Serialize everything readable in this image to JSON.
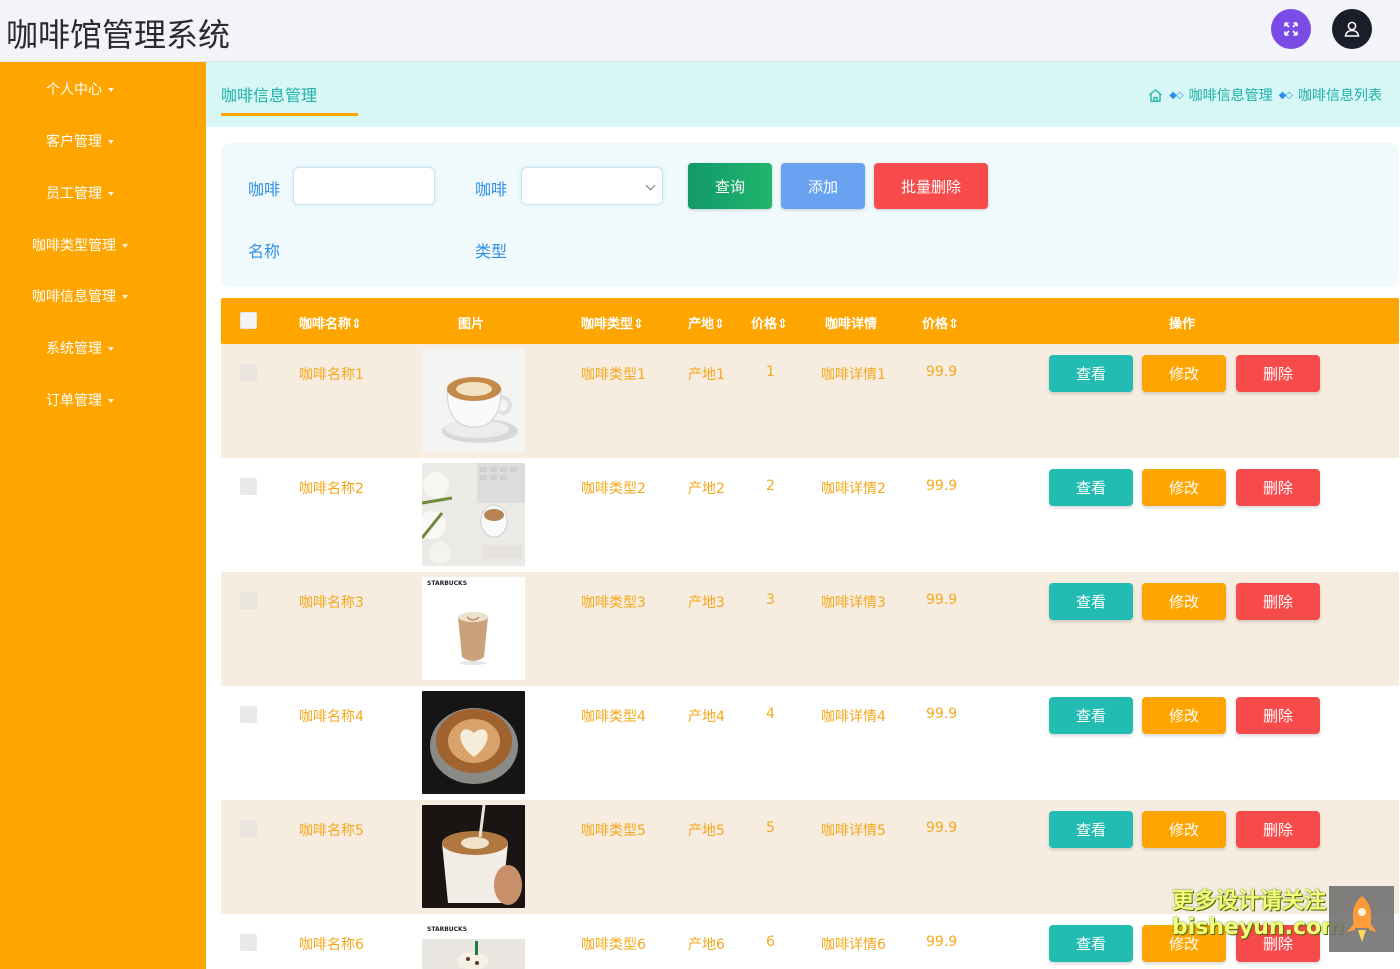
{
  "app": {
    "title": "咖啡馆管理系统"
  },
  "colors": {
    "accent": "#ffa500",
    "teal": "#1fb0a8",
    "blue": "#2f8fe6",
    "query": "#17a96a",
    "add": "#6aa2f2",
    "danger": "#f74a4a"
  },
  "icons": {
    "fullscreen": "fullscreen-icon",
    "user": "user-icon",
    "home": "home-icon"
  },
  "sidebar": {
    "items": [
      {
        "label": "个人中心"
      },
      {
        "label": "客户管理"
      },
      {
        "label": "员工管理"
      },
      {
        "label": "咖啡类型管理"
      },
      {
        "label": "咖啡信息管理"
      },
      {
        "label": "系统管理"
      },
      {
        "label": "订单管理"
      }
    ]
  },
  "page": {
    "tab": "咖啡信息管理",
    "breadcrumb": [
      "咖啡信息管理",
      "咖啡信息列表"
    ]
  },
  "search": {
    "name_label_1": "咖啡",
    "name_label_2": "名称",
    "type_label_1": "咖啡",
    "type_label_2": "类型",
    "name_value": "",
    "type_value": "",
    "query_label": "查询",
    "add_label": "添加",
    "batch_delete_label": "批量删除"
  },
  "table": {
    "headers": {
      "name": "咖啡名称",
      "image": "图片",
      "type": "咖啡类型",
      "origin": "产地",
      "price": "价格",
      "detail": "咖啡详情",
      "price2": "价格",
      "actions": "操作"
    },
    "rows": [
      {
        "name": "咖啡名称1",
        "type": "咖啡类型1",
        "origin": "产地1",
        "price": "1",
        "detail": "咖啡详情1",
        "price2": "99.9"
      },
      {
        "name": "咖啡名称2",
        "type": "咖啡类型2",
        "origin": "产地2",
        "price": "2",
        "detail": "咖啡详情2",
        "price2": "99.9"
      },
      {
        "name": "咖啡名称3",
        "type": "咖啡类型3",
        "origin": "产地3",
        "price": "3",
        "detail": "咖啡详情3",
        "price2": "99.9"
      },
      {
        "name": "咖啡名称4",
        "type": "咖啡类型4",
        "origin": "产地4",
        "price": "4",
        "detail": "咖啡详情4",
        "price2": "99.9"
      },
      {
        "name": "咖啡名称5",
        "type": "咖啡类型5",
        "origin": "产地5",
        "price": "5",
        "detail": "咖啡详情5",
        "price2": "99.9"
      },
      {
        "name": "咖啡名称6",
        "type": "咖啡类型6",
        "origin": "产地6",
        "price": "6",
        "detail": "咖啡详情6",
        "price2": "99.9"
      }
    ],
    "view_label": "查看",
    "edit_label": "修改",
    "delete_label": "删除",
    "thumb_brand": "STARBUCKS"
  },
  "watermark": {
    "line1": "更多设计请关注",
    "line2": "bisheyun.com"
  }
}
